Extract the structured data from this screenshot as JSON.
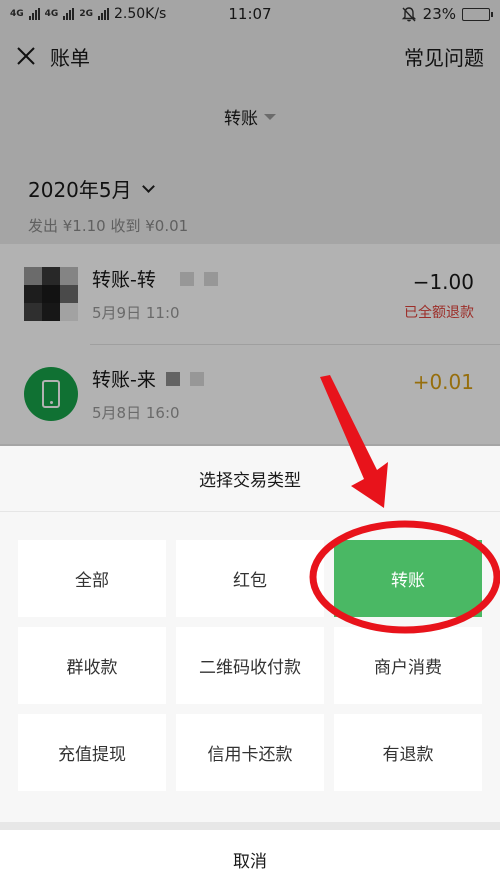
{
  "status_bar": {
    "network_speed": "2.50K/s",
    "time": "11:07",
    "battery": "23%",
    "battery_level": 0.23,
    "signal_labels": [
      "4G",
      "4G",
      "2G"
    ]
  },
  "navbar": {
    "close_icon": "close-icon",
    "title": "账单",
    "faq": "常见问题"
  },
  "filter": {
    "label": "转账",
    "icon": "caret-down-icon"
  },
  "month": {
    "label": "2020年5月",
    "summary": "发出 ¥1.10 收到 ¥0.01"
  },
  "transactions": [
    {
      "title": "转账-转",
      "date": "5月9日 11:0",
      "amount": "−1.00",
      "note": "已全额退款",
      "avatar": "mosaic-avatar"
    },
    {
      "title": "转账-来",
      "date": "5月8日 16:0",
      "amount": "+0.01",
      "note": "",
      "avatar": "phone-avatar"
    }
  ],
  "sheet": {
    "title": "选择交易类型",
    "options": [
      {
        "label": "全部",
        "selected": false
      },
      {
        "label": "红包",
        "selected": false
      },
      {
        "label": "转账",
        "selected": true
      },
      {
        "label": "群收款",
        "selected": false
      },
      {
        "label": "二维码收付款",
        "selected": false
      },
      {
        "label": "商户消费",
        "selected": false
      },
      {
        "label": "充值提现",
        "selected": false
      },
      {
        "label": "信用卡还款",
        "selected": false
      },
      {
        "label": "有退款",
        "selected": false
      }
    ],
    "cancel": "取消"
  },
  "colors": {
    "selected_option": "#4ab864",
    "income_amount": "#d79e12",
    "refund_note": "#e0433b",
    "annotation": "#e8131b"
  }
}
